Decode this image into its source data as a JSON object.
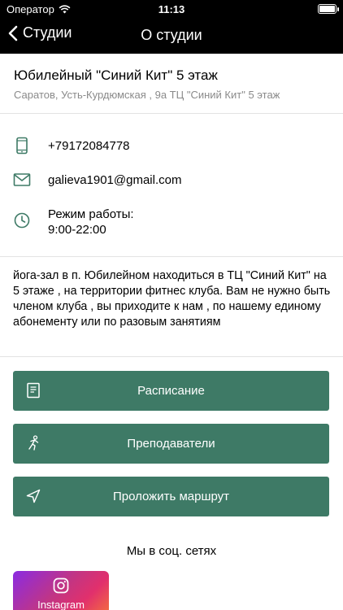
{
  "status_bar": {
    "carrier": "Оператор",
    "time": "11:13"
  },
  "nav": {
    "back_label": "Студии",
    "title": "О студии"
  },
  "studio": {
    "name": "Юбилейный \"Синий Кит\" 5 этаж",
    "address": "Саратов, Усть-Курдюмская , 9а  ТЦ \"Синий Кит\" 5 этаж"
  },
  "contacts": {
    "phone": "+79172084778",
    "email": "galieva1901@gmail.com",
    "hours_label": "Режим работы:",
    "hours_value": "9:00-22:00"
  },
  "description": "йога-зал в п. Юбилейном находиться в ТЦ \"Синий Кит\" на 5 этаже , на территории фитнес клуба. Вам не нужно быть членом клуба , вы приходите к нам , по нашему единому  абонементу или по разовым занятиям",
  "buttons": {
    "schedule": "Расписание",
    "teachers": "Преподаватели",
    "route": "Проложить маршрут"
  },
  "social": {
    "title": "Мы в соц. сетях",
    "instagram": "Instagram"
  },
  "colors": {
    "accent": "#3e7a66",
    "nav_bg": "#000000"
  }
}
